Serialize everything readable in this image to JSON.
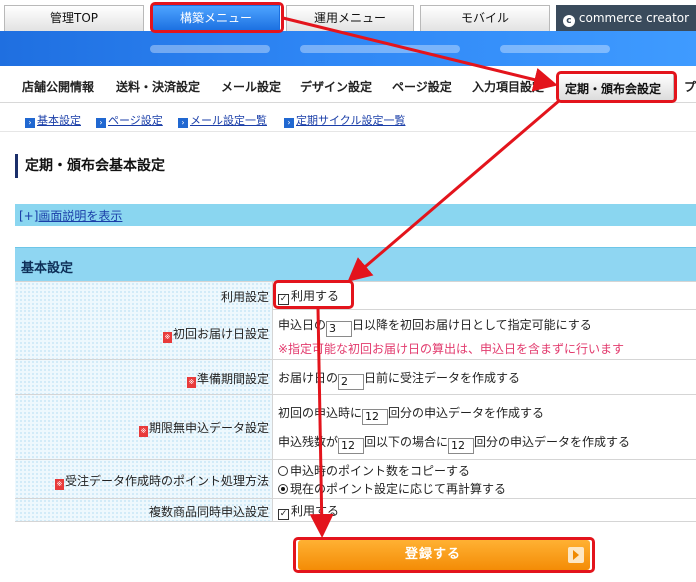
{
  "top_tabs": {
    "admin_top": "管理TOP",
    "build_menu": "構築メニュー",
    "ops_menu": "運用メニュー",
    "mobile": "モバイル",
    "brand": "commerce creator"
  },
  "main_menu": {
    "items": [
      "店舗公開情報",
      "送料・決済設定",
      "メール設定",
      "デザイン設定",
      "ページ設定",
      "入力項目設定"
    ],
    "active": "定期・頒布会設定",
    "overflow": "プ"
  },
  "sub_menu": [
    "基本設定",
    "ページ設定",
    "メール設定一覧",
    "定期サイクル設定一覧"
  ],
  "page_title": "定期・頒布会基本設定",
  "help_link": {
    "prefix": "[+]",
    "label": "画面説明を表示"
  },
  "section_title": "基本設定",
  "form": {
    "use_setting": {
      "label": "利用設定",
      "checkbox_label": "利用する",
      "checked": true
    },
    "first_delivery": {
      "label": "初回お届け日設定",
      "pre": "申込日の",
      "value": "3",
      "post": "日以降を初回お届け日として指定可能にする",
      "note": "※指定可能な初回お届け日の算出は、申込日を含まずに行います"
    },
    "prep_period": {
      "label": "準備期間設定",
      "pre": "お届け日の",
      "value": "2",
      "post": "日前に受注データを作成する"
    },
    "unlimited": {
      "label": "期限無申込データ設定",
      "line1_pre": "初回の申込時に",
      "line1_value": "12",
      "line1_post": "回分の申込データを作成する",
      "line2_pre": "申込残数が",
      "line2_value": "12",
      "line2_mid": "回以下の場合に",
      "line2_value2": "12",
      "line2_post": "回分の申込データを作成する"
    },
    "points": {
      "label": "受注データ作成時のポイント処理方法",
      "option1": "申込時のポイント数をコピーする",
      "option2": "現在のポイント設定に応じて再計算する",
      "selected": 2
    },
    "multi_product": {
      "label": "複数商品同時申込設定",
      "checkbox_label": "利用する",
      "checked": true
    }
  },
  "required_mark": "※",
  "submit_label": "登録する",
  "colors": {
    "highlight": "#e3141c",
    "brand_blue": "#1f6fe0",
    "section_bg": "#8fd6f2",
    "button_orange": "#f48c06",
    "note": "#e23a6d"
  }
}
